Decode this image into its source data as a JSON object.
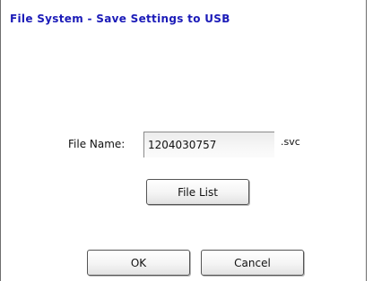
{
  "dialog": {
    "title": "File System - Save Settings to USB"
  },
  "form": {
    "file_name_label": "File Name:",
    "file_name_value": "1204030757",
    "extension": ".svc"
  },
  "buttons": {
    "file_list": "File List",
    "ok": "OK",
    "cancel": "Cancel"
  }
}
